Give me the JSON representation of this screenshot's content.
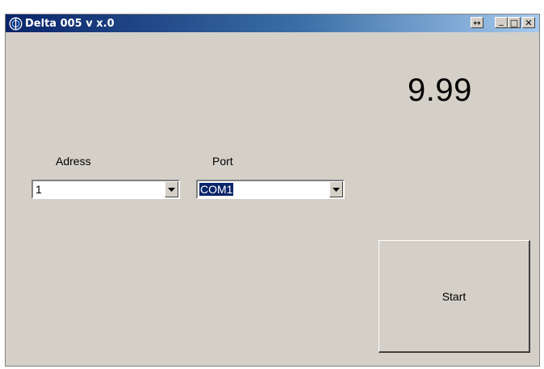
{
  "window": {
    "title": "Delta 005 v x.0",
    "icon": "app-logo-icon",
    "buttons": {
      "resize_glyph": "↔",
      "minimize_glyph": "_",
      "maximize_glyph": "□",
      "close_glyph": "✕"
    }
  },
  "display": {
    "value": "9.99"
  },
  "address": {
    "label": "Adress",
    "value": "1"
  },
  "port": {
    "label": "Port",
    "value": "COM1"
  },
  "actions": {
    "start_label": "Start"
  },
  "colors": {
    "face": "#d4d0c8",
    "title_start": "#0a246a",
    "title_end": "#a6caf0",
    "selection": "#0a246a"
  }
}
